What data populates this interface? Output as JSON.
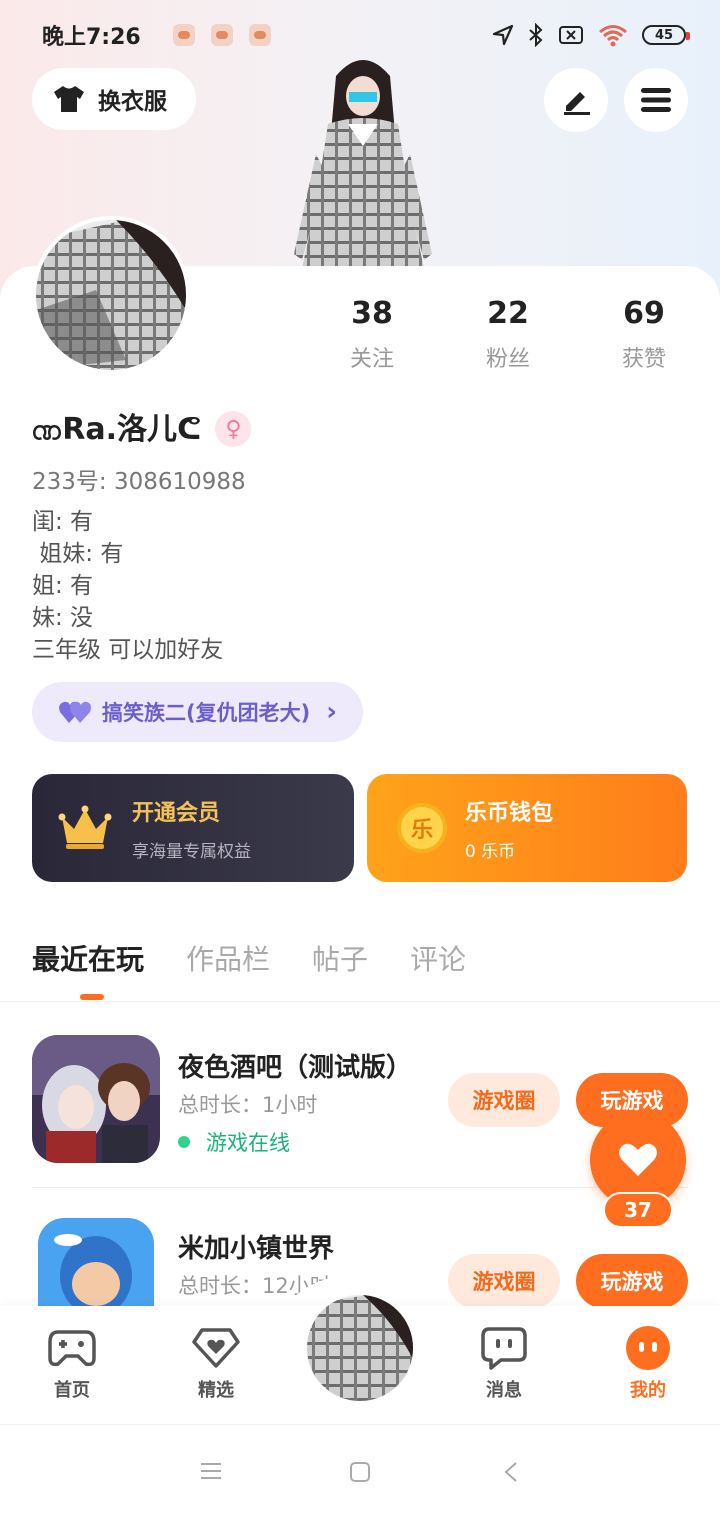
{
  "status_bar": {
    "time": "晚上7:26",
    "battery": "45",
    "icons": [
      "location-icon",
      "bluetooth-icon",
      "sim-off-icon",
      "wifi-icon",
      "battery-icon"
    ]
  },
  "header": {
    "outfit_label": "换衣服",
    "outfit_icon": "tshirt-icon",
    "edit_icon": "pen-icon",
    "menu_icon": "hamburger-menu-icon"
  },
  "profile": {
    "stats": [
      {
        "value": "38",
        "label": "关注"
      },
      {
        "value": "22",
        "label": "粉丝"
      },
      {
        "value": "69",
        "label": "获赞"
      }
    ],
    "nickname": "ဏRa.洛儿ᕦ",
    "gender_symbol": "♀",
    "uid": "233号: 308610988",
    "bio": "闺: 有\n 姐妹: 有\n姐: 有\n妹: 没\n三年级 可以加好友",
    "family_label": "搞笑族二(复仇团老大)",
    "family_arrow": "›"
  },
  "promos": {
    "vip_title": "开通会员",
    "vip_sub": "享海量专属权益",
    "wallet_title": "乐币钱包",
    "wallet_sub": "0 乐币",
    "wallet_coin": "乐"
  },
  "tabs": [
    "最近在玩",
    "作品栏",
    "帖子",
    "评论"
  ],
  "games": [
    {
      "name": "夜色酒吧（测试版）",
      "playtime": "总时长：1小时",
      "status": "游戏在线",
      "circle_label": "游戏圈",
      "play_label": "玩游戏"
    },
    {
      "name": "米加小镇世界",
      "playtime": "总时长：12小时",
      "circle_label": "游戏圈",
      "play_label": "玩游戏"
    }
  ],
  "favorite_count": "37",
  "bottom_nav": [
    {
      "label": "首页",
      "icon": "gamepad-icon"
    },
    {
      "label": "精选",
      "icon": "heart-diamond-icon"
    },
    {
      "label": "消息",
      "icon": "chat-icon"
    },
    {
      "label": "我的",
      "icon": "profile-face-icon"
    }
  ],
  "colors": {
    "accent": "#ff6e1f",
    "online": "#1bb37a",
    "family": "#6b5fce"
  }
}
